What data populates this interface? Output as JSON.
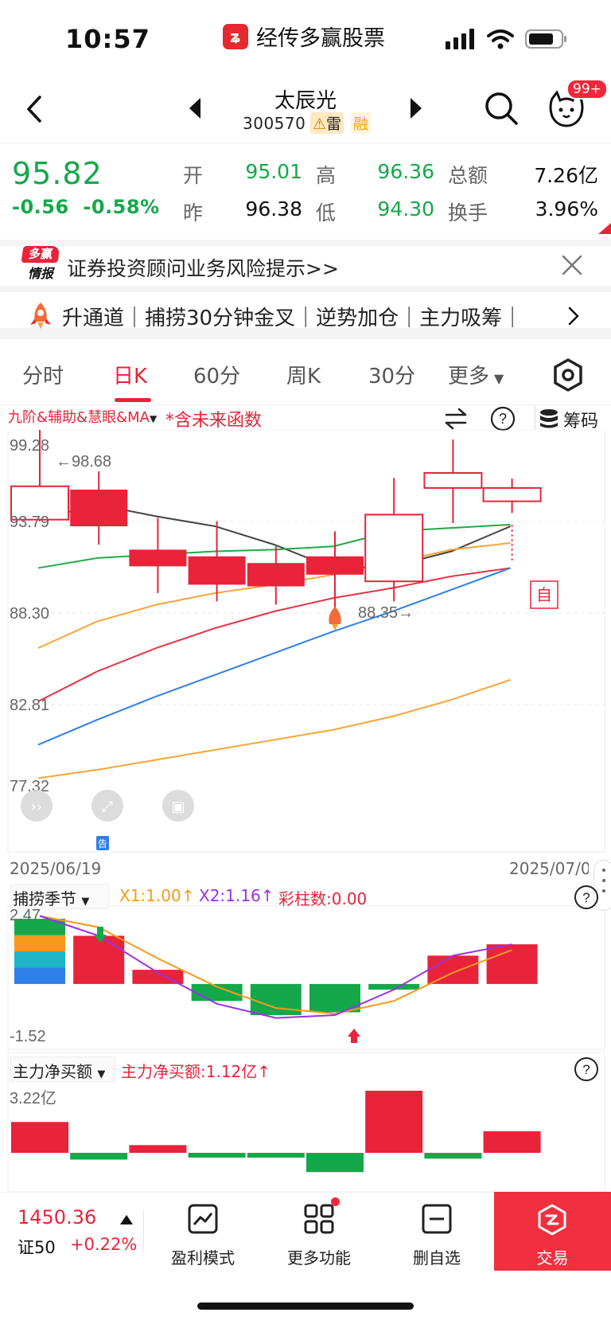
{
  "status_bar": {
    "time": "10:57",
    "app_title": "经传多赢股票"
  },
  "header": {
    "stock_name": "太辰光",
    "stock_code": "300570",
    "badge_risk": "雷",
    "badge_margin": "融",
    "notification_count": "99+"
  },
  "quote": {
    "price": "95.82",
    "change": "-0.56",
    "change_pct": "-0.58%",
    "open_label": "开",
    "open": "95.01",
    "high_label": "高",
    "high": "96.36",
    "amount_label": "总额",
    "amount": "7.26亿",
    "prev_label": "昨",
    "prev_close": "96.38",
    "low_label": "低",
    "low": "94.30",
    "turnover_label": "换手",
    "turnover": "3.96%"
  },
  "notice": {
    "logo_line1": "多赢",
    "logo_line2": "情报",
    "text": "证券投资顾问业务风险提示>>"
  },
  "ticker": {
    "text": "升通道｜捕捞30分钟金叉｜逆势加仓｜主力吸筹｜"
  },
  "tabs": [
    {
      "label": "分时"
    },
    {
      "label": "日K"
    },
    {
      "label": "60分"
    },
    {
      "label": "周K"
    },
    {
      "label": "30分"
    },
    {
      "label": "更多"
    }
  ],
  "chart_toolbar": {
    "indicators": "九阶&辅助&慧眼&MA",
    "future_note": "*含未来函数",
    "chips": "筹码"
  },
  "kline": {
    "y_labels": [
      "99.28",
      "93.79",
      "88.30",
      "82.81",
      "77.32"
    ],
    "high_marker": "98.68",
    "low_marker": "88.35",
    "self_label": "自",
    "gao_label": "告",
    "date_start": "2025/06/19",
    "date_end": "2025/07/0"
  },
  "sub1": {
    "name": "捕捞季节",
    "x1": "X1:1.00↑",
    "x2": "X2:1.16↑",
    "bars": "彩柱数:0.00",
    "y_top": "2.47",
    "y_bottom": "-1.52"
  },
  "sub2": {
    "name": "主力净买额",
    "value": "主力净买额:1.12亿↑",
    "y_top": "3.22亿"
  },
  "bottom_bar": {
    "index_value": "1450.36",
    "index_name": "证50",
    "index_change": "+0.22%",
    "btn_profit": "盈利模式",
    "btn_more": "更多功能",
    "btn_remove": "删自选",
    "btn_trade": "交易"
  },
  "colors": {
    "up": "#e8233a",
    "down": "#15a84a",
    "accent": "#e8233a"
  },
  "chart_data": [
    {
      "type": "candlestick",
      "title": "日K",
      "ylim": [
        77.32,
        99.28
      ],
      "candles": [
        {
          "open": 93.9,
          "close": 95.9,
          "high": 99.3,
          "low": 93.8,
          "dir": "up"
        },
        {
          "open": 95.7,
          "close": 93.5,
          "high": 96.8,
          "low": 92.4,
          "dir": "down"
        },
        {
          "open": 92.1,
          "close": 91.1,
          "high": 94.0,
          "low": 89.5,
          "dir": "down"
        },
        {
          "open": 91.7,
          "close": 90.0,
          "high": 93.8,
          "low": 89.0,
          "dir": "down"
        },
        {
          "open": 91.3,
          "close": 89.9,
          "high": 92.3,
          "low": 88.8,
          "dir": "down"
        },
        {
          "open": 91.7,
          "close": 90.6,
          "high": 93.2,
          "low": 88.35,
          "dir": "down"
        },
        {
          "open": 90.2,
          "close": 94.2,
          "high": 96.4,
          "low": 89.0,
          "dir": "up"
        },
        {
          "open": 95.8,
          "close": 96.7,
          "high": 98.7,
          "low": 93.7,
          "dir": "up"
        },
        {
          "open": 95.0,
          "close": 95.8,
          "high": 96.36,
          "low": 94.3,
          "dir": "up"
        }
      ],
      "ma_lines": [
        {
          "color": "#444444",
          "values": [
            93.9,
            94.8,
            94.1,
            93.5,
            92.4,
            91.0,
            91.1,
            92.0,
            93.5
          ]
        },
        {
          "color": "#22aa44",
          "values": [
            91.0,
            91.6,
            91.8,
            92.0,
            92.1,
            92.3,
            93.2,
            93.4,
            93.6
          ]
        },
        {
          "color": "#f5a53a",
          "values": [
            86.2,
            87.8,
            88.8,
            89.5,
            90.0,
            90.6,
            91.3,
            92.1,
            92.5
          ]
        },
        {
          "color": "#e8334a",
          "values": [
            83.0,
            84.8,
            86.2,
            87.4,
            88.4,
            89.2,
            89.8,
            90.5,
            91.0
          ]
        },
        {
          "color": "#2f7fe8",
          "values": [
            80.4,
            81.9,
            83.3,
            84.6,
            85.9,
            87.2,
            88.4,
            89.7,
            91.0
          ]
        },
        {
          "color": "#f5a53a",
          "values": [
            78.4,
            78.9,
            79.5,
            80.1,
            80.7,
            81.3,
            82.1,
            83.1,
            84.3
          ]
        }
      ]
    },
    {
      "type": "bar",
      "title": "捕捞季节",
      "ylim": [
        -1.52,
        2.47
      ],
      "values": [
        2.3,
        1.7,
        0.5,
        -0.6,
        -1.1,
        -1.0,
        -0.2,
        1.0,
        1.4
      ],
      "series": [
        {
          "name": "X1",
          "color": "#f59a1a",
          "values": [
            2.4,
            2.0,
            0.9,
            -0.1,
            -0.85,
            -1.05,
            -0.6,
            0.4,
            1.2
          ]
        },
        {
          "name": "X2",
          "color": "#9b30e8",
          "values": [
            2.4,
            1.7,
            0.4,
            -0.7,
            -1.2,
            -1.1,
            -0.2,
            1.0,
            1.4
          ]
        }
      ]
    },
    {
      "type": "bar",
      "title": "主力净买额",
      "ylim": [
        -1.0,
        3.22
      ],
      "values": [
        1.6,
        -0.35,
        0.4,
        -0.2,
        -0.2,
        -1.0,
        3.22,
        -0.3,
        1.12
      ]
    }
  ]
}
